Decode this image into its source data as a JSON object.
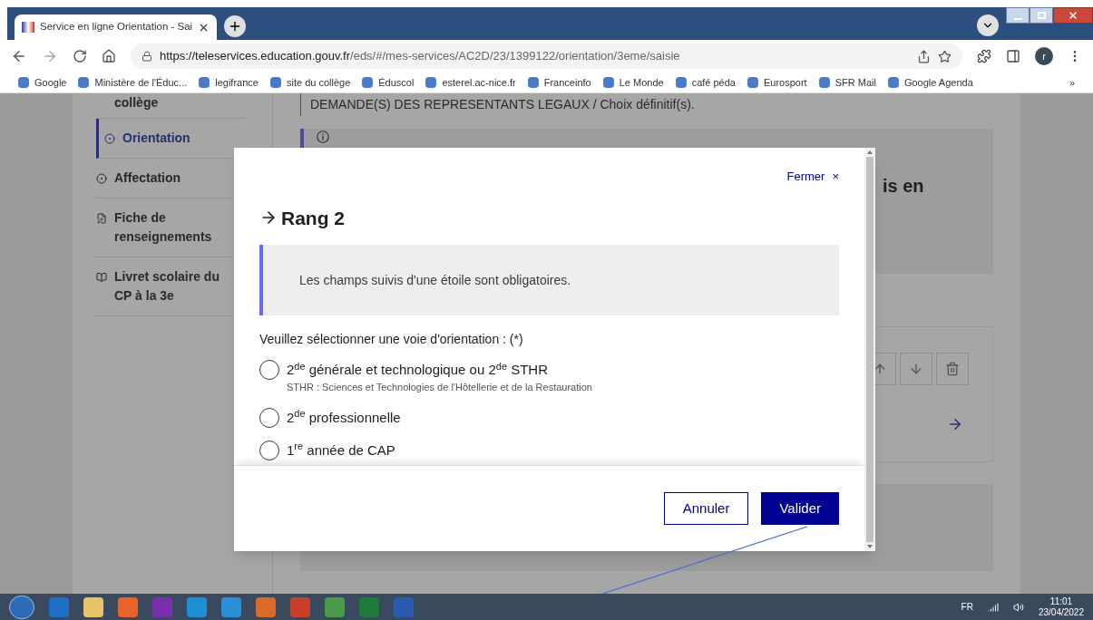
{
  "browser": {
    "tab": {
      "title": "Service en ligne Orientation - Sai",
      "selected": true
    },
    "url": {
      "host": "https://teleservices.education.gouv.fr",
      "path": "/eds/#/mes-services/AC2D/23/1399122/orientation/3eme/saisie"
    },
    "profile_initial": "r",
    "bookmarks": [
      {
        "label": "Google"
      },
      {
        "label": "Ministère de l'Éduc..."
      },
      {
        "label": "legifrance"
      },
      {
        "label": "site du collège"
      },
      {
        "label": "Éduscol"
      },
      {
        "label": "esterel.ac-nice.fr"
      },
      {
        "label": "Franceinfo"
      },
      {
        "label": "Le Monde"
      },
      {
        "label": "café péda"
      },
      {
        "label": "Eurosport"
      },
      {
        "label": "SFR Mail"
      },
      {
        "label": "Google Agenda"
      }
    ],
    "bookmarks_more": "»"
  },
  "sidebar": {
    "items": [
      {
        "label": "collège",
        "selected": false
      },
      {
        "label": "Orientation",
        "selected": true
      },
      {
        "label": "Affectation",
        "selected": false
      },
      {
        "label": "Fiche de renseignements",
        "selected": false
      },
      {
        "label": "Livret scolaire du CP à la 3e",
        "selected": false
      }
    ]
  },
  "main": {
    "heading": "DEMANDE(S) DES REPRESENTANTS LEGAUX / Choix définitif(s).",
    "notice_fragment": "is en"
  },
  "modal": {
    "close_label": "Fermer",
    "close_glyph": "×",
    "title": "Rang 2",
    "notice": "Les champs suivis d'une étoile sont obligatoires.",
    "question": "Veuillez sélectionner une voie d'orientation : (*)",
    "options": [
      {
        "label": "2$^{de}$ générale et technologique ou 2$^{de}$ STHR",
        "hint": "STHR : Sciences et Technologies de l'Hôtellerie et de la Restauration",
        "selected": false
      },
      {
        "label": "2$^{de}$ professionnelle",
        "selected": false
      },
      {
        "label": "1$^{re}$ année de CAP",
        "selected": false
      }
    ],
    "buttons": [
      {
        "label": "Annuler",
        "kind": "secondary"
      },
      {
        "label": "Valider",
        "kind": "primary"
      }
    ]
  },
  "taskbar": {
    "language": "FR",
    "time": "11:01",
    "date": "23/04/2022"
  }
}
